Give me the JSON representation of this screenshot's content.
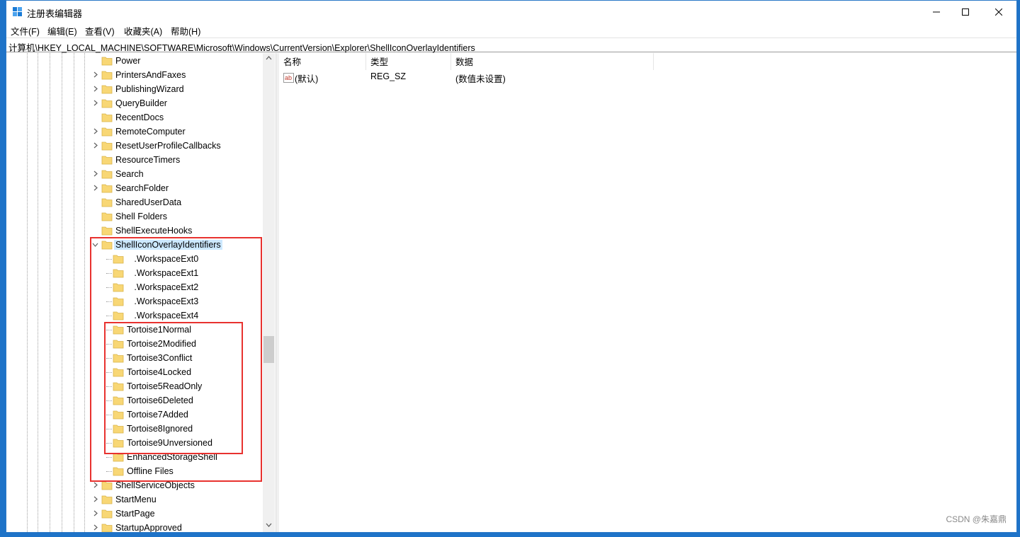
{
  "window": {
    "title": "注册表编辑器",
    "controls": {
      "minimize": "minimize",
      "maximize": "maximize",
      "close": "close"
    }
  },
  "menu": [
    "文件(F)",
    "编辑(E)",
    "查看(V)",
    "收藏夹(A)",
    "帮助(H)"
  ],
  "address": "计算机\\HKEY_LOCAL_MACHINE\\SOFTWARE\\Microsoft\\Windows\\CurrentVersion\\Explorer\\ShellIconOverlayIdentifiers",
  "tree": {
    "items": [
      {
        "label": "Power",
        "level": 0,
        "expander": false
      },
      {
        "label": "PrintersAndFaxes",
        "level": 0,
        "expander": true
      },
      {
        "label": "PublishingWizard",
        "level": 0,
        "expander": true
      },
      {
        "label": "QueryBuilder",
        "level": 0,
        "expander": true
      },
      {
        "label": "RecentDocs",
        "level": 0,
        "expander": false
      },
      {
        "label": "RemoteComputer",
        "level": 0,
        "expander": true
      },
      {
        "label": "ResetUserProfileCallbacks",
        "level": 0,
        "expander": true
      },
      {
        "label": "ResourceTimers",
        "level": 0,
        "expander": false
      },
      {
        "label": "Search",
        "level": 0,
        "expander": true
      },
      {
        "label": "SearchFolder",
        "level": 0,
        "expander": true
      },
      {
        "label": "SharedUserData",
        "level": 0,
        "expander": false
      },
      {
        "label": "Shell Folders",
        "level": 0,
        "expander": false
      },
      {
        "label": "ShellExecuteHooks",
        "level": 0,
        "expander": false
      },
      {
        "label": "ShellIconOverlayIdentifiers",
        "level": 0,
        "expander": "open",
        "selected": true
      },
      {
        "label": "   .WorkspaceExt0",
        "level": 1,
        "expander": false
      },
      {
        "label": "   .WorkspaceExt1",
        "level": 1,
        "expander": false
      },
      {
        "label": "   .WorkspaceExt2",
        "level": 1,
        "expander": false
      },
      {
        "label": "   .WorkspaceExt3",
        "level": 1,
        "expander": false
      },
      {
        "label": "   .WorkspaceExt4",
        "level": 1,
        "expander": false
      },
      {
        "label": "Tortoise1Normal",
        "level": 1,
        "expander": false
      },
      {
        "label": "Tortoise2Modified",
        "level": 1,
        "expander": false
      },
      {
        "label": "Tortoise3Conflict",
        "level": 1,
        "expander": false
      },
      {
        "label": "Tortoise4Locked",
        "level": 1,
        "expander": false
      },
      {
        "label": "Tortoise5ReadOnly",
        "level": 1,
        "expander": false
      },
      {
        "label": "Tortoise6Deleted",
        "level": 1,
        "expander": false
      },
      {
        "label": "Tortoise7Added",
        "level": 1,
        "expander": false
      },
      {
        "label": "Tortoise8Ignored",
        "level": 1,
        "expander": false
      },
      {
        "label": "Tortoise9Unversioned",
        "level": 1,
        "expander": false
      },
      {
        "label": "EnhancedStorageShell",
        "level": 1,
        "expander": false
      },
      {
        "label": "Offline Files",
        "level": 1,
        "expander": false
      },
      {
        "label": "ShellServiceObjects",
        "level": 0,
        "expander": true
      },
      {
        "label": "StartMenu",
        "level": 0,
        "expander": true
      },
      {
        "label": "StartPage",
        "level": 0,
        "expander": true
      },
      {
        "label": "StartupApproved",
        "level": 0,
        "expander": true
      }
    ]
  },
  "list": {
    "columns": [
      "名称",
      "类型",
      "数据"
    ],
    "rows": [
      {
        "name": "(默认)",
        "type": "REG_SZ",
        "data": "(数值未设置)"
      }
    ]
  },
  "colors": {
    "highlight": "#e8322f",
    "selection": "#cce8ff",
    "folder": "#f8d775",
    "desktop": "#1e73c8"
  },
  "watermark": "CSDN @朱嘉鼎"
}
